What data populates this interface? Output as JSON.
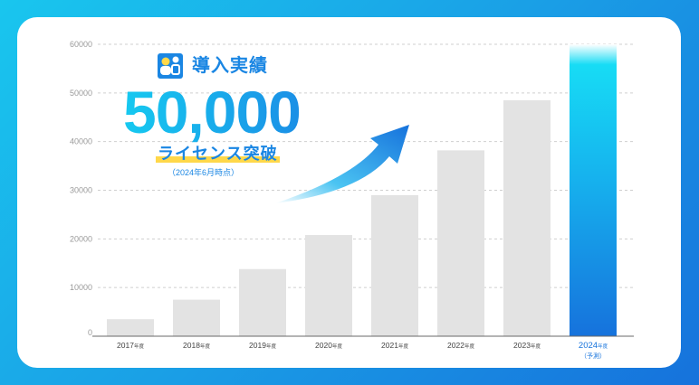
{
  "headline": "導入実績",
  "big_number": "50,000",
  "license_text": "ライセンス突破",
  "license_note": "（2024年6月時点）",
  "colors": {
    "bar": "#e3e3e3",
    "highlight_top": "#17dcf5",
    "highlight_bottom": "#1672dc",
    "accent": "#1a86e3",
    "underline": "#ffd84a"
  },
  "badge_icon": "people-icon",
  "arrow_icon": "up-trend-arrow-icon",
  "chart_data": {
    "type": "bar",
    "categories": [
      "2017",
      "2018",
      "2019",
      "2020",
      "2021",
      "2022",
      "2023",
      "2024"
    ],
    "category_suffix": "年度",
    "highlight_note": "（予測）",
    "values": [
      3500,
      7500,
      13800,
      20800,
      29000,
      38200,
      48500,
      60000
    ],
    "highlight_index": 7,
    "yticks": [
      0,
      10000,
      20000,
      30000,
      40000,
      50000,
      60000
    ],
    "ylim": [
      0,
      60000
    ],
    "grid": true,
    "title": "",
    "xlabel": "",
    "ylabel": ""
  }
}
